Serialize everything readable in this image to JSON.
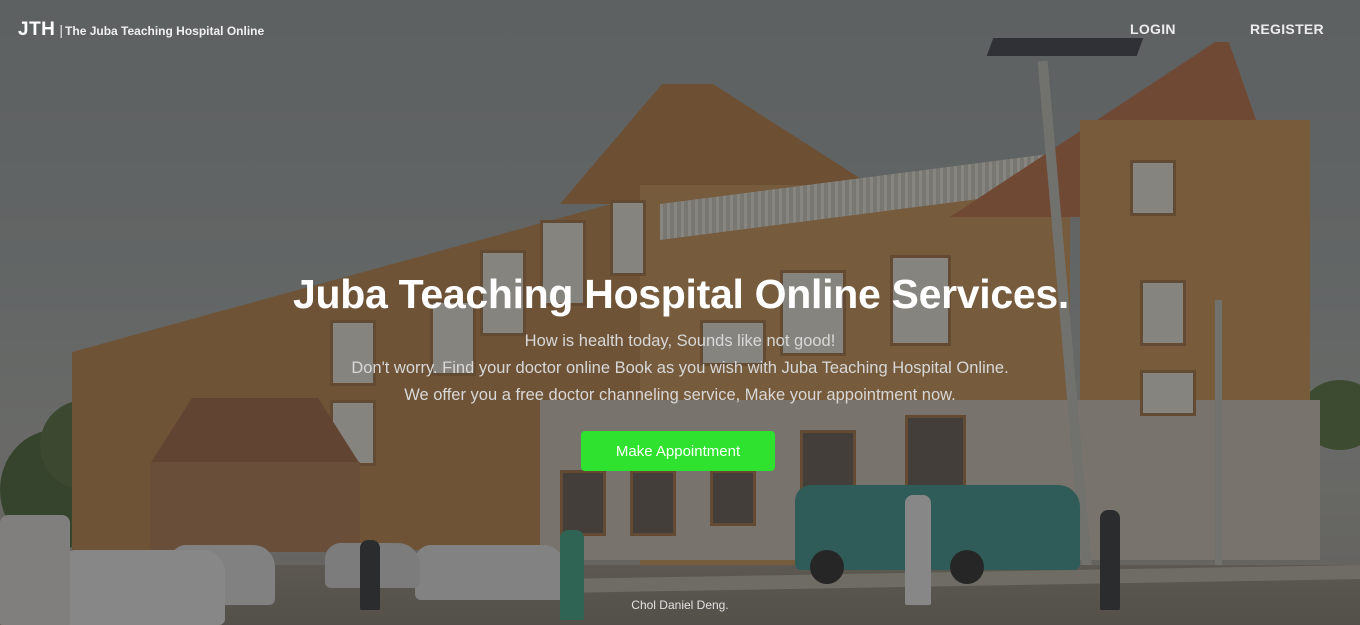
{
  "header": {
    "brand_mark": "JTH",
    "brand_separator": "|",
    "brand_tagline": "The Juba Teaching Hospital Online",
    "nav": {
      "login": "LOGIN",
      "register": "REGISTER"
    }
  },
  "hero": {
    "title": "Juba Teaching Hospital Online Services.",
    "lines": [
      "How is health today, Sounds like not good!",
      "Don't worry. Find your doctor online Book as you wish with Juba Teaching Hospital Online.",
      "We offer you a free doctor channeling service, Make your appointment now."
    ],
    "cta_label": "Make Appointment"
  },
  "footer": {
    "credit": "Chol Daniel Deng."
  },
  "colors": {
    "cta": "#2ee22f",
    "overlay": "rgba(48,48,48,0.52)"
  }
}
